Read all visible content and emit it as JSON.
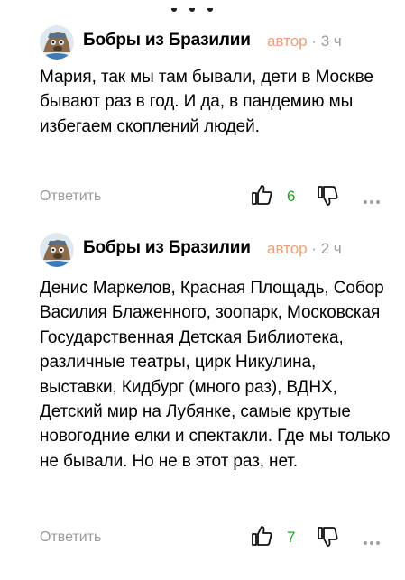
{
  "comments": [
    {
      "author": "Бобры из Бразилии",
      "badge": "автор",
      "separator": " · ",
      "time": "3 ч",
      "text": "Мария, так мы там бывали, дети в Москве бывают раз в год. И да, в пандемию мы избегаем скоплений людей.",
      "reply_label": "Ответить",
      "likes": "6"
    },
    {
      "author": "Бобры из Бразилии",
      "badge": "автор",
      "separator": " · ",
      "time": "2 ч",
      "text": "Денис Маркелов, Красная Площадь, Собор Василия Блаженного, зоопарк, Московская Государственная Детская Библиотека, различные театры, цирк Никулина, выставки, Кидбург (много раз), ВДНХ, Детский мир на Лубянке, самые крутые новогодние елки и спектакли. Где мы только не бывали. Но не в этот раз, нет.",
      "reply_label": "Ответить",
      "likes": "7"
    }
  ],
  "colors": {
    "badge": "#e8a17a",
    "likes": "#2aa22a",
    "muted": "#9a9a9a"
  },
  "icons": [
    "beaver-avatar",
    "thumb-up-icon",
    "thumb-down-icon",
    "more-icon"
  ]
}
